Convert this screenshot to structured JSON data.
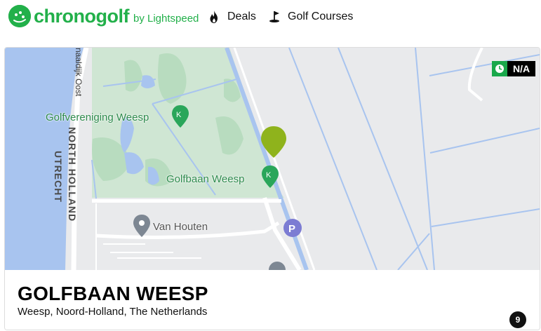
{
  "brand": {
    "name": "chronogolf",
    "tagline": "by Lightspeed",
    "accent_color": "#22b04a"
  },
  "nav": {
    "deals": {
      "label": "Deals",
      "icon": "flame-icon"
    },
    "courses": {
      "label": "Golf Courses",
      "icon": "golf-flag-icon"
    }
  },
  "course": {
    "name": "GOLFBAAN WEESP",
    "location": "Weesp, Noord-Holland, The Netherlands",
    "holes": "9",
    "rating": "N/A",
    "status_color": "#19a84b"
  },
  "map": {
    "labels": {
      "road": "Amsterdam-Rijnkanaaldijk Oost",
      "road_visible": "naaldijk Oost",
      "region1": "NORTH HOLLAND",
      "region2": "UTRECHT",
      "club": "Golfvereniging Weesp",
      "course": "Golfbaan Weesp",
      "poi": "Van Houten"
    }
  }
}
